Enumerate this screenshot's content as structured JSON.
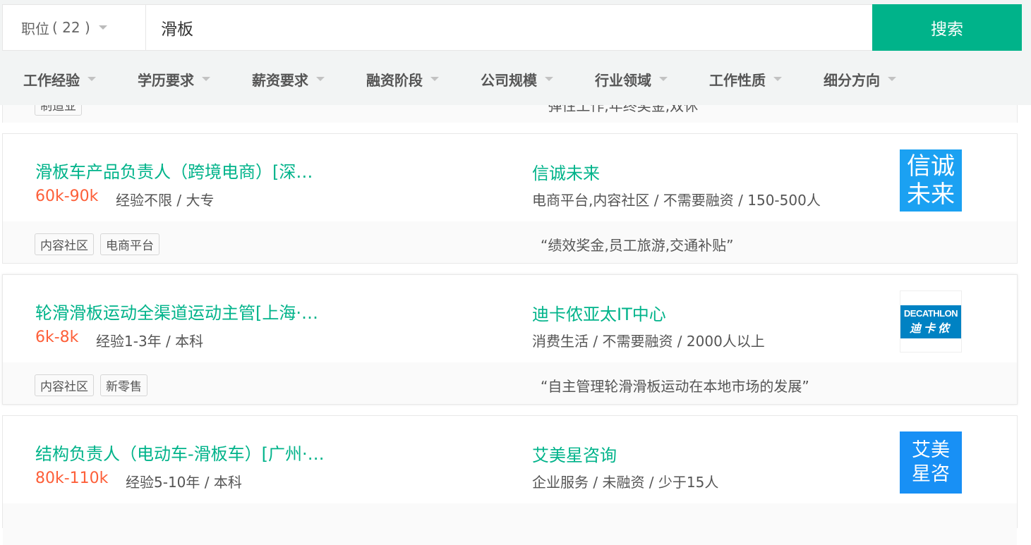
{
  "search": {
    "type_label": "职位",
    "type_count": "( 22 )",
    "query": "滑板",
    "button": "搜索"
  },
  "filters": [
    "工作经验",
    "学历要求",
    "薪资要求",
    "融资阶段",
    "公司规模",
    "行业领域",
    "工作性质",
    "细分方向"
  ],
  "partial_card": {
    "tag": "制造业",
    "benefit": "“弹性工作,年终奖金,双休”"
  },
  "jobs": [
    {
      "title": "滑板车产品负责人（跨境电商）[深…",
      "salary": "60k-90k",
      "requirements": "经验不限 / 大专",
      "company": "信诚未来",
      "company_info": "电商平台,内容社区 / 不需要融资 / 150-500人",
      "logo_lines": [
        "信诚",
        "未来"
      ],
      "logo_color": "#1ba1f2",
      "tags": [
        "内容社区",
        "电商平台"
      ],
      "benefit": "“绩效奖金,员工旅游,交通补贴”"
    },
    {
      "title": "轮滑滑板运动全渠道运动主管[上海·…",
      "salary": "6k-8k",
      "requirements": "经验1-3年 / 本科",
      "company": "迪卡侬亚太IT中心",
      "company_info": "消费生活 / 不需要融资 / 2000人以上",
      "logo_lines": [
        "DECATHLON",
        "迪卡侬"
      ],
      "logo_color": "#0082c3",
      "tags": [
        "内容社区",
        "新零售"
      ],
      "benefit": "“自主管理轮滑滑板运动在本地市场的发展”"
    },
    {
      "title": "结构负责人（电动车-滑板车）[广州·…",
      "salary": "80k-110k",
      "requirements": "经验5-10年 / 本科",
      "company": "艾美星咨询",
      "company_info": "企业服务 / 未融资 / 少于15人",
      "logo_lines": [
        "艾美",
        "星咨"
      ],
      "logo_color": "#1890f5",
      "tags": [],
      "benefit": ""
    }
  ]
}
